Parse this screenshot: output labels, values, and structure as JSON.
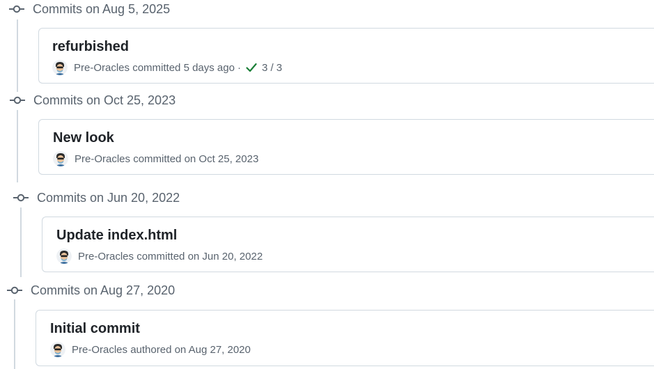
{
  "colors": {
    "border": "#d1d9e0",
    "muted_text": "#59636e",
    "title_text": "#1f2328",
    "success": "#1a7f37"
  },
  "groups": [
    {
      "header": "Commits on Aug 5, 2025",
      "commit": {
        "title": "refurbished",
        "author": "Pre-Oracles",
        "action": "committed",
        "when": "5 days ago",
        "separator": "·",
        "checks": "3 / 3",
        "check_icon": "check-icon"
      }
    },
    {
      "header": "Commits on Oct 25, 2023",
      "commit": {
        "title": "New look",
        "author": "Pre-Oracles",
        "action": "committed",
        "when": "on Oct 25, 2023"
      }
    },
    {
      "header": "Commits on Jun 20, 2022",
      "commit": {
        "title": "Update index.html",
        "author": "Pre-Oracles",
        "action": "committed",
        "when": "on Jun 20, 2022"
      }
    },
    {
      "header": "Commits on Aug 27, 2020",
      "commit": {
        "title": "Initial commit",
        "author": "Pre-Oracles",
        "action": "authored",
        "when": "on Aug 27, 2020"
      }
    }
  ],
  "icons": {
    "timeline": "git-commit-icon",
    "avatar": "user-avatar"
  }
}
